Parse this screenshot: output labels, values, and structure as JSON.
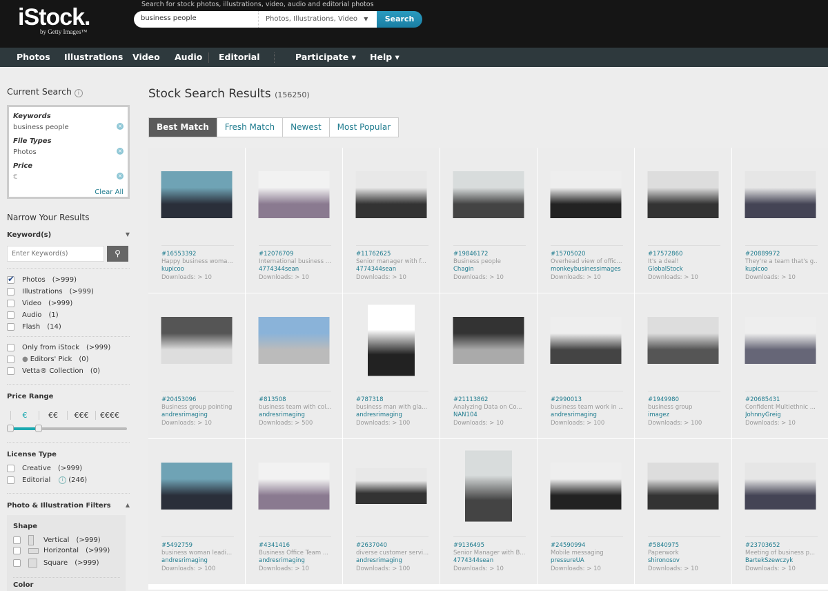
{
  "header": {
    "logo": "iStock.",
    "logo_sub": "by Getty Images™",
    "tagline": "Search for stock photos, illustrations, video, audio and editorial photos",
    "search_value": "business people",
    "type_select": "Photos, Illustrations, Video",
    "search_button": "Search"
  },
  "nav": [
    "Photos",
    "Illustrations",
    "Video",
    "Audio",
    "Editorial",
    "Participate ▾",
    "Help ▾"
  ],
  "sidebar": {
    "current_search": "Current Search",
    "keywords_label": "Keywords",
    "keywords_value": "business people",
    "filetypes_label": "File Types",
    "filetypes_value": "Photos",
    "price_label": "Price",
    "price_value": "€",
    "clear_all": "Clear All",
    "narrow": "Narrow Your Results",
    "keywords_heading": "Keyword(s)",
    "keyword_placeholder": "Enter Keyword(s)",
    "types": [
      {
        "label": "Photos",
        "count": "(>999)",
        "checked": true
      },
      {
        "label": "Illustrations",
        "count": "(>999)",
        "checked": false
      },
      {
        "label": "Video",
        "count": "(>999)",
        "checked": false
      },
      {
        "label": "Audio",
        "count": "(1)",
        "checked": false
      },
      {
        "label": "Flash",
        "count": "(14)",
        "checked": false
      }
    ],
    "collections": [
      {
        "label": "Only from iStock",
        "count": "(>999)"
      },
      {
        "label": "Editors' Pick",
        "count": "(0)"
      },
      {
        "label": "Vetta® Collection",
        "count": "(0)"
      }
    ],
    "price_range": "Price Range",
    "price_levels": [
      "€",
      "€€",
      "€€€",
      "€€€€"
    ],
    "price_selected": "€",
    "license_type": "License Type",
    "licenses": [
      {
        "label": "Creative",
        "count": "(>999)"
      },
      {
        "label": "Editorial",
        "count": "(246)"
      }
    ],
    "filters": "Photo & Illustration Filters",
    "shape": "Shape",
    "shapes": [
      {
        "label": "Vertical",
        "count": "(>999)"
      },
      {
        "label": "Horizontal",
        "count": "(>999)"
      },
      {
        "label": "Square",
        "count": "(>999)"
      }
    ],
    "color": "Color"
  },
  "main": {
    "title": "Stock Search Results",
    "count": "(156250)",
    "sort_tabs": [
      "Best Match",
      "Fresh Match",
      "Newest",
      "Most Popular"
    ],
    "active_sort": "Best Match",
    "results": [
      {
        "id": "#16553392",
        "title": "Happy business woma...",
        "author": "kupicoo",
        "downloads": "Downloads: > 10",
        "orientation": "landscape"
      },
      {
        "id": "#12076709",
        "title": "International business ...",
        "author": "4774344sean",
        "downloads": "Downloads: > 10",
        "orientation": "landscape"
      },
      {
        "id": "#11762625",
        "title": "Senior manager with f...",
        "author": "4774344sean",
        "downloads": "Downloads: > 10",
        "orientation": "landscape"
      },
      {
        "id": "#19846172",
        "title": "Business people",
        "author": "Chagin",
        "downloads": "Downloads: > 10",
        "orientation": "landscape"
      },
      {
        "id": "#15705020",
        "title": "Overhead view of offic...",
        "author": "monkeybusinessimages",
        "downloads": "Downloads: > 10",
        "orientation": "landscape"
      },
      {
        "id": "#17572860",
        "title": "It's a deal!",
        "author": "GlobalStock",
        "downloads": "Downloads: > 10",
        "orientation": "landscape"
      },
      {
        "id": "#20889972",
        "title": "They're a team that's g...",
        "author": "kupicoo",
        "downloads": "Downloads: > 10",
        "orientation": "landscape"
      },
      {
        "id": "#20453096",
        "title": "Business group pointing",
        "author": "andresrimaging",
        "downloads": "Downloads: > 10",
        "orientation": "landscape"
      },
      {
        "id": "#813508",
        "title": "business team with col...",
        "author": "andresrimaging",
        "downloads": "Downloads: > 500",
        "orientation": "landscape"
      },
      {
        "id": "#787318",
        "title": "business man with gla...",
        "author": "andresrimaging",
        "downloads": "Downloads: > 100",
        "orientation": "portrait"
      },
      {
        "id": "#21113862",
        "title": "Analyzing Data on Co...",
        "author": "NAN104",
        "downloads": "Downloads: > 10",
        "orientation": "landscape"
      },
      {
        "id": "#2990013",
        "title": "business team work in ...",
        "author": "andresrimaging",
        "downloads": "Downloads: > 100",
        "orientation": "landscape"
      },
      {
        "id": "#1949980",
        "title": "business group",
        "author": "imagez",
        "downloads": "Downloads: > 100",
        "orientation": "landscape"
      },
      {
        "id": "#20685431",
        "title": "Confident Multiethnic ...",
        "author": "JohnnyGreig",
        "downloads": "Downloads: > 10",
        "orientation": "landscape"
      },
      {
        "id": "#5492759",
        "title": "business woman leadi...",
        "author": "andresrimaging",
        "downloads": "Downloads: > 100",
        "orientation": "landscape"
      },
      {
        "id": "#4341416",
        "title": "Business Office Team ...",
        "author": "andresrimaging",
        "downloads": "Downloads: > 10",
        "orientation": "landscape"
      },
      {
        "id": "#2637040",
        "title": "diverse customer servi...",
        "author": "andresrimaging",
        "downloads": "Downloads: > 100",
        "orientation": "wide"
      },
      {
        "id": "#9136495",
        "title": "Senior Manager with B...",
        "author": "4774344sean",
        "downloads": "Downloads: > 10",
        "orientation": "portrait"
      },
      {
        "id": "#24590994",
        "title": "Mobile messaging",
        "author": "pressureUA",
        "downloads": "Downloads: > 10",
        "orientation": "landscape"
      },
      {
        "id": "#5840975",
        "title": "Paperwork",
        "author": "shironosov",
        "downloads": "Downloads: > 10",
        "orientation": "landscape"
      },
      {
        "id": "#23703652",
        "title": "Meeting of business p...",
        "author": "BartekSzewczyk",
        "downloads": "Downloads: > 10",
        "orientation": "landscape"
      }
    ]
  },
  "colors": {
    "accent": "#1e7b8e",
    "search_button": "#1a7ea3",
    "nav_bg": "#2e393d",
    "header_bg": "#151515"
  }
}
